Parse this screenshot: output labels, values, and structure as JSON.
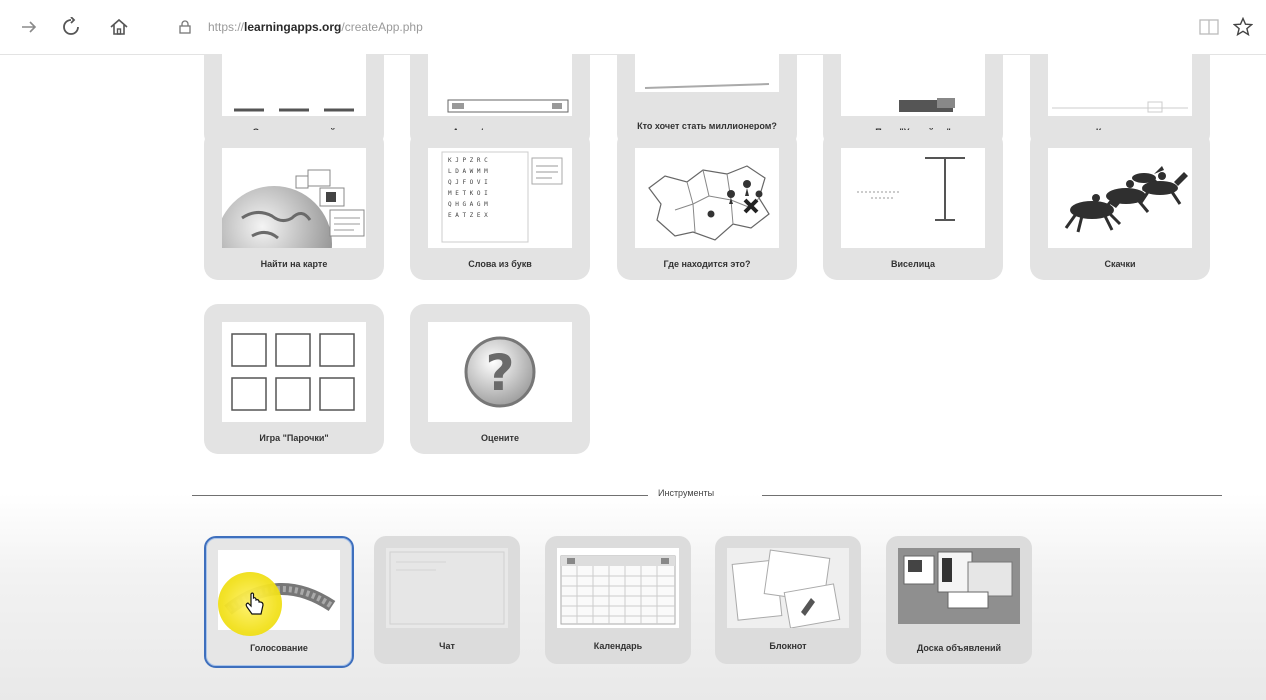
{
  "browser": {
    "url_prefix": "https://",
    "url_host": "learningapps.org",
    "url_path": "/createApp.php"
  },
  "top_row": [
    {
      "label": "Сетка приложений"
    },
    {
      "label": "Аудио/видео контент"
    },
    {
      "label": "Кто хочет стать миллионером?"
    },
    {
      "label": "Пазл \"Угадай-ка\""
    },
    {
      "label": "Кроссворд"
    }
  ],
  "row2": [
    {
      "label": "Найти на карте"
    },
    {
      "label": "Слова из букв"
    },
    {
      "label": "Где находится это?"
    },
    {
      "label": "Виселица"
    },
    {
      "label": "Скачки"
    }
  ],
  "row3": [
    {
      "label": "Игра \"Парочки\""
    },
    {
      "label": "Оцените"
    }
  ],
  "tools_section": {
    "title": "Инструменты"
  },
  "tools": [
    {
      "label": "Голосование"
    },
    {
      "label": "Чат"
    },
    {
      "label": "Календарь"
    },
    {
      "label": "Блокнот"
    },
    {
      "label": "Доска объявлений"
    }
  ],
  "colors": {
    "selected_border": "#3e6fbd",
    "cursor_highlight": "#f2e11e"
  }
}
